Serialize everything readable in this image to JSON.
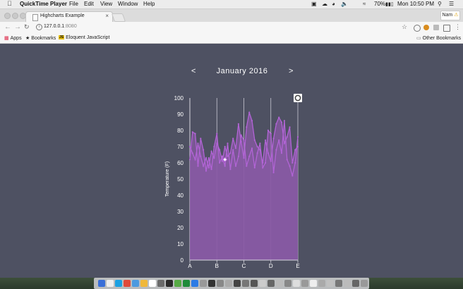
{
  "menubar": {
    "app_name": "QuickTime Player",
    "items": [
      "File",
      "Edit",
      "View",
      "Window",
      "Help"
    ],
    "battery": "70%",
    "clock": "Mon 10:50 PM"
  },
  "browser": {
    "tab_title": "Highcharts Example",
    "tab_close": "×",
    "user": "Nam",
    "url_host": "127.0.0.1",
    "url_port": ":8080",
    "bookmarks": {
      "apps": "Apps",
      "bookmarks": "Bookmarks",
      "eloquent": "Eloquent JavaScript",
      "eloquent_badge": "JS",
      "other": "Other Bookmarks"
    }
  },
  "page": {
    "prev_label": "<",
    "next_label": ">",
    "month_title": "January 2016"
  },
  "colors": {
    "background": "#4e5162",
    "area_fill": "#8a5aa6",
    "area_line": "#b264d6",
    "axis_text": "#ffffff"
  },
  "chart_data": {
    "type": "area",
    "ylabel": "Temperature (F)",
    "xlabel": "",
    "categories": [
      "A",
      "B",
      "C",
      "D",
      "E"
    ],
    "ylim": [
      0,
      100
    ],
    "yticks": [
      0,
      10,
      20,
      30,
      40,
      50,
      60,
      70,
      80,
      90,
      100
    ],
    "series": [
      {
        "type": "line",
        "x": [
          0,
          0.1,
          0.2,
          0.3,
          0.4,
          0.5,
          0.6,
          0.7,
          0.8,
          0.9,
          1,
          1.1,
          1.2,
          1.3,
          1.4,
          1.5,
          1.6,
          1.7,
          1.8,
          1.9,
          2,
          2.1,
          2.2,
          2.3,
          2.4,
          2.5,
          2.6,
          2.7,
          2.8,
          2.9,
          3,
          3.1,
          3.2,
          3.3,
          3.4,
          3.5,
          3.6,
          3.7,
          3.8,
          3.9,
          4
        ],
        "values": [
          70,
          66,
          62,
          72,
          64,
          58,
          63,
          57,
          67,
          63,
          72,
          68,
          61,
          70,
          64,
          66,
          75,
          69,
          84,
          73,
          63,
          82,
          91,
          86,
          74,
          70,
          68,
          60,
          74,
          66,
          61,
          75,
          84,
          88,
          85,
          72,
          76,
          82,
          60,
          68,
          70
        ]
      },
      {
        "type": "line",
        "x": [
          0,
          0.1,
          0.2,
          0.3,
          0.4,
          0.5,
          0.6,
          0.7,
          0.8,
          0.9,
          1,
          1.1,
          1.2,
          1.3,
          1.4,
          1.5,
          1.6,
          1.7,
          1.8,
          1.9,
          2,
          2.1,
          2.2,
          2.3,
          2.4,
          2.5,
          2.6,
          2.7,
          2.8,
          2.9,
          3,
          3.1,
          3.2,
          3.3,
          3.4,
          3.5,
          3.6,
          3.7,
          3.8,
          3.9,
          4
        ],
        "values": [
          62,
          79,
          78,
          58,
          75,
          68,
          55,
          63,
          56,
          70,
          78,
          60,
          64,
          58,
          72,
          56,
          68,
          58,
          64,
          77,
          74,
          58,
          64,
          69,
          57,
          66,
          72,
          57,
          60,
          80,
          78,
          54,
          68,
          74,
          66,
          86,
          62,
          58,
          52,
          60,
          76
        ]
      }
    ],
    "marker": {
      "x": 1.3,
      "y": 62,
      "symbol": "diamond"
    },
    "grid": {
      "vertical": true,
      "horizontal": false
    },
    "legend": "none"
  }
}
